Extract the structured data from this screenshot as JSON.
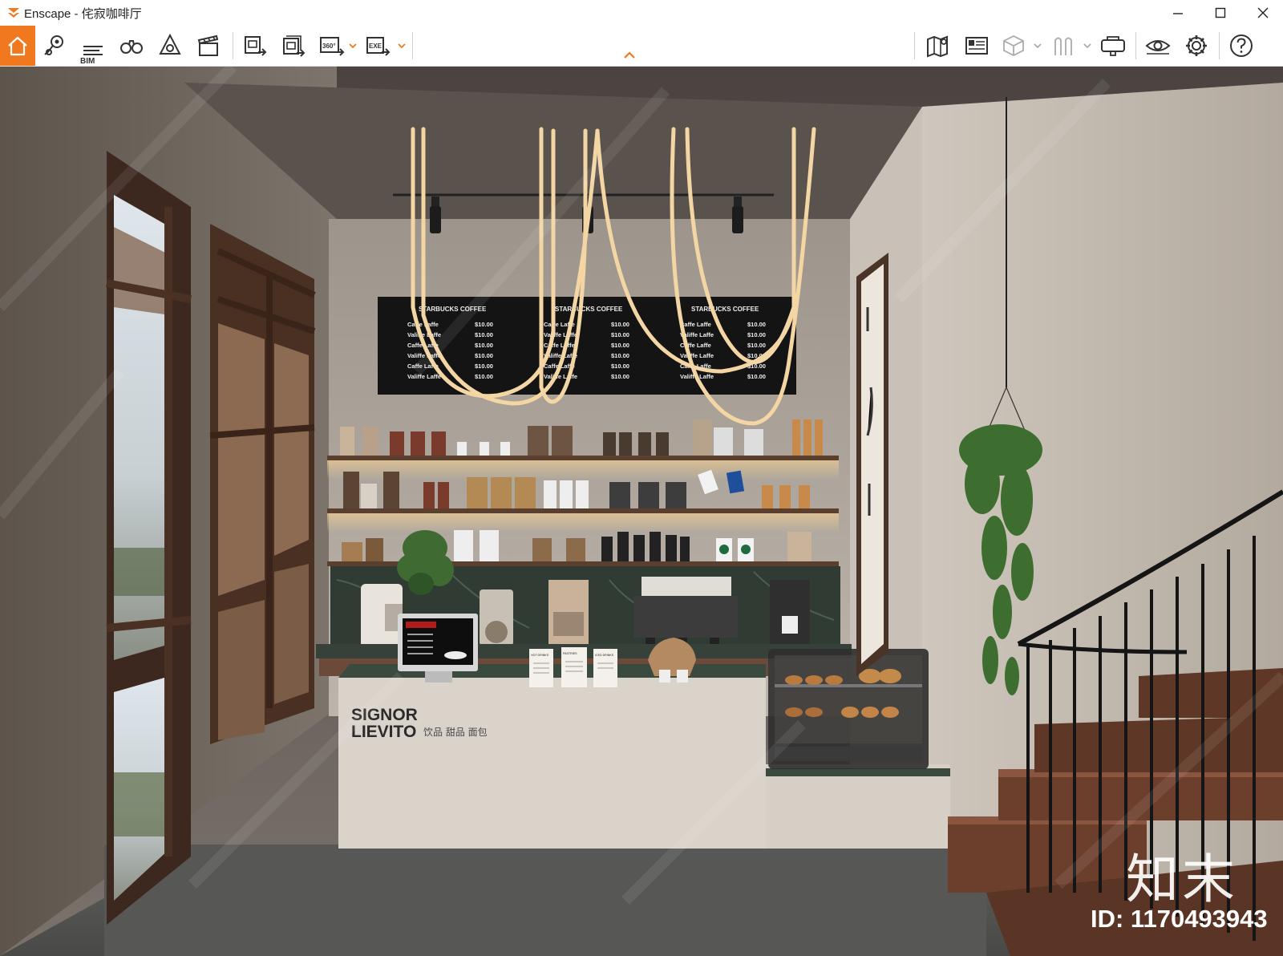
{
  "window": {
    "app_name": "Enscape",
    "separator": "-",
    "project_name": "侘寂咖啡厅",
    "controls": [
      "minimize-icon",
      "maximize-icon",
      "close-icon"
    ]
  },
  "toolbar": {
    "accent_color": "#f0781e",
    "left_tools": [
      {
        "id": "home",
        "icon": "home-icon",
        "active": true
      },
      {
        "id": "views",
        "icon": "location-pin-icon"
      },
      {
        "id": "bim",
        "icon": "bim-icon",
        "label": "BIM"
      },
      {
        "id": "binoculars",
        "icon": "binoculars-icon"
      },
      {
        "id": "atmosphere",
        "icon": "atmosphere-icon"
      },
      {
        "id": "video",
        "icon": "clapperboard-icon"
      },
      {
        "id": "screenshot",
        "icon": "render-screenshot-icon"
      },
      {
        "id": "batch",
        "icon": "batch-render-icon"
      },
      {
        "id": "panorama",
        "icon": "panorama-360-icon",
        "label": "360°"
      },
      {
        "id": "export",
        "icon": "export-exe-icon",
        "label": "EXE"
      }
    ],
    "right_tools": [
      {
        "id": "map",
        "icon": "map-icon"
      },
      {
        "id": "minimap",
        "icon": "minimap-icon"
      },
      {
        "id": "box",
        "icon": "box-icon"
      },
      {
        "id": "asset",
        "icon": "asset-library-icon"
      },
      {
        "id": "vr",
        "icon": "vr-headset-icon"
      },
      {
        "id": "eye",
        "icon": "eye-icon"
      },
      {
        "id": "settings",
        "icon": "gear-icon"
      },
      {
        "id": "help",
        "icon": "help-icon"
      }
    ],
    "collapse_icon": "chevron-up-icon"
  },
  "scene": {
    "menu_board": {
      "panels": [
        {
          "header": "STARBUCKS COFFEE",
          "items": [
            {
              "name": "Caffe Laffe",
              "price": "$10.00"
            },
            {
              "name": "Valiffe Laffe",
              "price": "$10.00"
            },
            {
              "name": "Caffe Laffe",
              "price": "$10.00"
            },
            {
              "name": "Valiffe Laffe",
              "price": "$10.00"
            },
            {
              "name": "Caffe Laffe",
              "price": "$10.00"
            },
            {
              "name": "Valiffe Laffe",
              "price": "$10.00"
            }
          ]
        },
        {
          "header": "STARBUCKS COFFEE",
          "items": [
            {
              "name": "Caffe Laffe",
              "price": "$10.00"
            },
            {
              "name": "Valiffe Laffe",
              "price": "$10.00"
            },
            {
              "name": "Caffe Laffe",
              "price": "$10.00"
            },
            {
              "name": "Valiffe Laffe",
              "price": "$10.00"
            },
            {
              "name": "Caffe Laffe",
              "price": "$10.00"
            },
            {
              "name": "Valiffe Laffe",
              "price": "$10.00"
            }
          ]
        },
        {
          "header": "STARBUCKS COFFEE",
          "items": [
            {
              "name": "Caffe Laffe",
              "price": "$10.00"
            },
            {
              "name": "Valiffe Laffe",
              "price": "$10.00"
            },
            {
              "name": "Caffe Laffe",
              "price": "$10.00"
            },
            {
              "name": "Valiffe Laffe",
              "price": "$10.00"
            },
            {
              "name": "Caffe Laffe",
              "price": "$10.00"
            },
            {
              "name": "Valiffe Laffe",
              "price": "$10.00"
            }
          ]
        }
      ]
    },
    "counter_brand_line1": "SIGNOR",
    "counter_brand_line2": "LIEVITO",
    "counter_tagline": "饮品 甜品 面包",
    "menu_cards": [
      "HOT DRINKS",
      "PASTRIES",
      "ICED DRINKS"
    ]
  },
  "watermark": {
    "logo_text": "知末",
    "id_text": "ID: 1170493943"
  }
}
